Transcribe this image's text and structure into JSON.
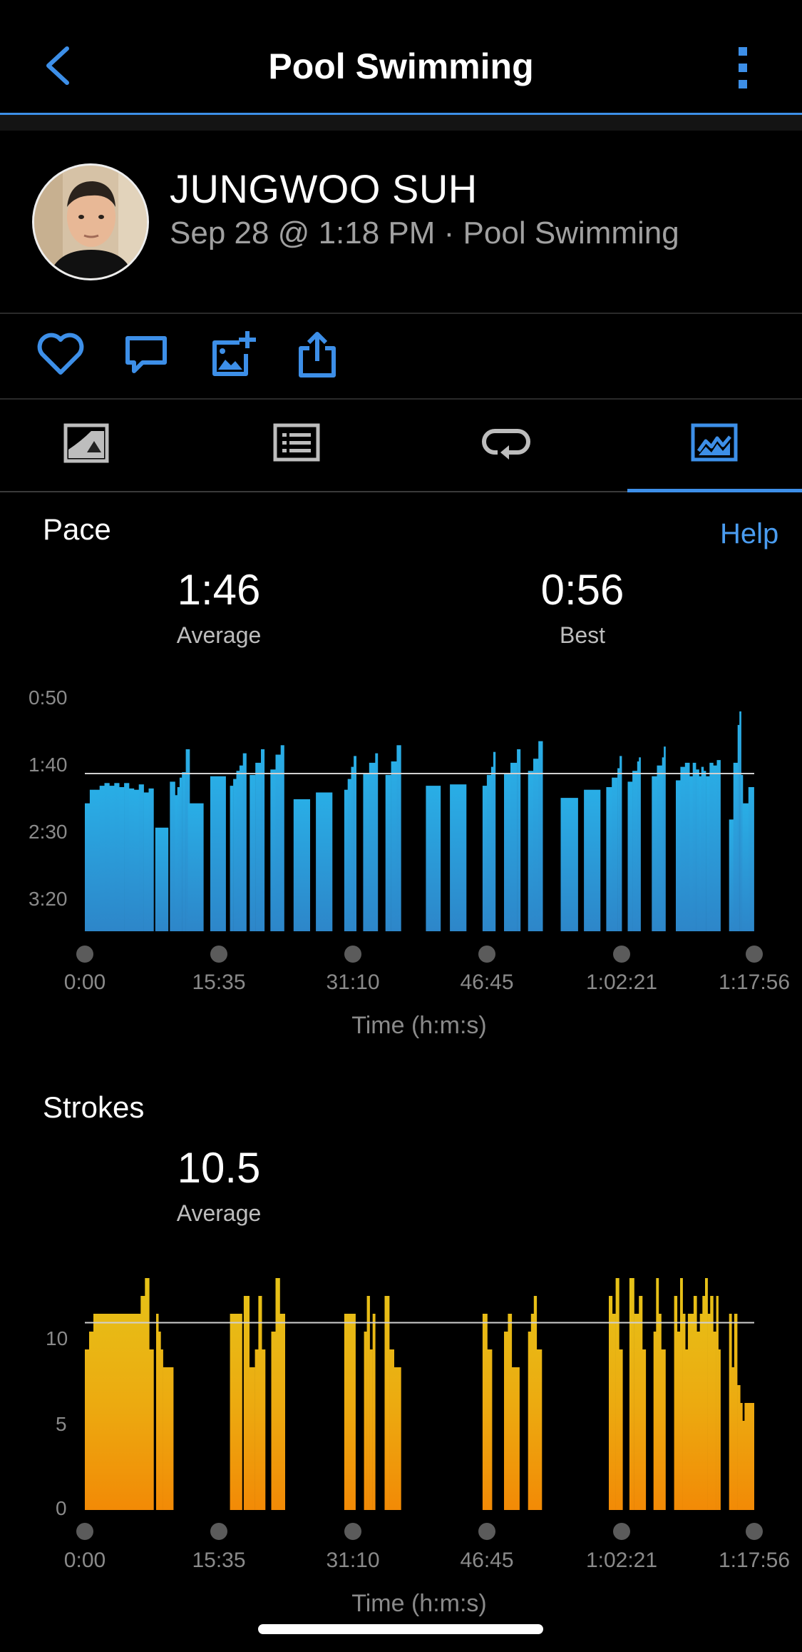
{
  "header": {
    "title": "Pool Swimming"
  },
  "profile": {
    "athlete_name": "JUNGWOO SUH",
    "subtitle": "Sep 28 @ 1:18 PM · Pool Swimming"
  },
  "actions": [
    {
      "icon": "heart-icon"
    },
    {
      "icon": "comment-icon"
    },
    {
      "icon": "add-photo-icon"
    },
    {
      "icon": "share-icon"
    }
  ],
  "tabs": [
    {
      "icon": "map-tab-icon"
    },
    {
      "icon": "list-tab-icon"
    },
    {
      "icon": "laps-tab-icon"
    },
    {
      "icon": "charts-tab-icon",
      "active": true
    }
  ],
  "pace": {
    "title": "Pace",
    "help": "Help",
    "average_value": "1:46",
    "average_label": "Average",
    "best_value": "0:56",
    "best_label": "Best"
  },
  "strokes": {
    "title": "Strokes",
    "average_value": "10.5",
    "average_label": "Average"
  },
  "colors": {
    "accent": "#3d8fe8",
    "pace_bar": "#29aee6",
    "strokes_top": "#e6c318",
    "strokes_bottom": "#f28a06"
  },
  "chart_data": [
    {
      "type": "bar",
      "name": "pace",
      "xlabel": "Time (h:m:s)",
      "ylabel": "",
      "x_ticks": [
        "0:00",
        "15:35",
        "31:10",
        "46:45",
        "1:02:21",
        "1:17:56"
      ],
      "y_ticks": [
        "0:50",
        "1:40",
        "2:30",
        "3:20"
      ],
      "ylim_seconds": [
        30,
        230
      ],
      "average_seconds": 106,
      "xlim_minutes": [
        0,
        77.93
      ],
      "intervals": [
        {
          "start": 0.0,
          "end": 8.0,
          "values": [
            128,
            118,
            118,
            115,
            113,
            115,
            113,
            116,
            113,
            117,
            118,
            114,
            120,
            117
          ]
        },
        {
          "start": 8.2,
          "end": 9.7,
          "values": [
            146
          ]
        },
        {
          "start": 9.9,
          "end": 10.5,
          "values": [
            112
          ]
        },
        {
          "start": 10.5,
          "end": 11.3,
          "values": [
            122,
            116,
            109
          ]
        },
        {
          "start": 11.3,
          "end": 12.2,
          "values": [
            105,
            88
          ]
        },
        {
          "start": 12.0,
          "end": 13.8,
          "values": [
            128
          ]
        },
        {
          "start": 14.6,
          "end": 16.4,
          "values": [
            108
          ]
        },
        {
          "start": 16.9,
          "end": 18.0,
          "values": [
            115,
            110,
            104
          ]
        },
        {
          "start": 18.0,
          "end": 18.8,
          "values": [
            100,
            91
          ]
        },
        {
          "start": 19.2,
          "end": 20.5,
          "values": [
            107,
            98
          ]
        },
        {
          "start": 20.5,
          "end": 20.9,
          "values": [
            88
          ]
        },
        {
          "start": 21.6,
          "end": 22.8,
          "values": [
            103,
            92
          ]
        },
        {
          "start": 22.8,
          "end": 23.2,
          "values": [
            85
          ]
        },
        {
          "start": 24.3,
          "end": 26.2,
          "values": [
            125
          ]
        },
        {
          "start": 26.9,
          "end": 28.8,
          "values": [
            120
          ]
        },
        {
          "start": 30.2,
          "end": 31.0,
          "values": [
            118,
            110
          ]
        },
        {
          "start": 31.0,
          "end": 31.6,
          "values": [
            101,
            93
          ]
        },
        {
          "start": 32.4,
          "end": 33.8,
          "values": [
            106,
            98
          ]
        },
        {
          "start": 33.8,
          "end": 34.1,
          "values": [
            91
          ]
        },
        {
          "start": 35.0,
          "end": 36.3,
          "values": [
            107,
            97
          ]
        },
        {
          "start": 36.3,
          "end": 36.8,
          "values": [
            85
          ]
        },
        {
          "start": 39.7,
          "end": 41.4,
          "values": [
            115
          ]
        },
        {
          "start": 42.5,
          "end": 44.4,
          "values": [
            114
          ]
        },
        {
          "start": 46.3,
          "end": 47.3,
          "values": [
            115,
            107
          ]
        },
        {
          "start": 47.3,
          "end": 47.8,
          "values": [
            101,
            90
          ]
        },
        {
          "start": 48.8,
          "end": 50.3,
          "values": [
            106,
            98
          ]
        },
        {
          "start": 50.3,
          "end": 50.7,
          "values": [
            88
          ]
        },
        {
          "start": 51.6,
          "end": 52.8,
          "values": [
            104,
            95
          ]
        },
        {
          "start": 52.8,
          "end": 53.3,
          "values": [
            82
          ]
        },
        {
          "start": 55.4,
          "end": 57.4,
          "values": [
            124
          ]
        },
        {
          "start": 58.1,
          "end": 60.0,
          "values": [
            118
          ]
        },
        {
          "start": 60.7,
          "end": 62.0,
          "values": [
            116,
            109
          ]
        },
        {
          "start": 62.0,
          "end": 62.5,
          "values": [
            102,
            93
          ]
        },
        {
          "start": 63.2,
          "end": 64.3,
          "values": [
            112,
            104
          ]
        },
        {
          "start": 64.3,
          "end": 64.7,
          "values": [
            97,
            94
          ]
        },
        {
          "start": 66.0,
          "end": 67.2,
          "values": [
            108,
            100
          ]
        },
        {
          "start": 67.2,
          "end": 67.6,
          "values": [
            94,
            86
          ]
        },
        {
          "start": 68.8,
          "end": 70.4,
          "values": [
            111,
            101,
            98
          ]
        },
        {
          "start": 70.4,
          "end": 71.5,
          "values": [
            108,
            98,
            103
          ]
        },
        {
          "start": 71.5,
          "end": 72.3,
          "values": [
            108,
            101,
            104
          ]
        },
        {
          "start": 72.3,
          "end": 74.0,
          "values": [
            108,
            98,
            100,
            96
          ]
        },
        {
          "start": 75.0,
          "end": 76.0,
          "values": [
            140,
            98
          ]
        },
        {
          "start": 76.0,
          "end": 76.6,
          "values": [
            70,
            60,
            107
          ]
        },
        {
          "start": 76.6,
          "end": 77.9,
          "values": [
            128,
            116
          ]
        }
      ]
    },
    {
      "type": "bar",
      "name": "strokes",
      "xlabel": "Time (h:m:s)",
      "ylabel": "",
      "x_ticks": [
        "0:00",
        "15:35",
        "31:10",
        "46:45",
        "1:02:21",
        "1:17:56"
      ],
      "y_ticks": [
        "10",
        "5",
        "0"
      ],
      "ylim": [
        0,
        13
      ],
      "average": 10.5,
      "xlim_minutes": [
        0,
        77.93
      ],
      "intervals": [
        {
          "start": 0.0,
          "end": 0.5,
          "values": [
            9
          ]
        },
        {
          "start": 0.5,
          "end": 1.0,
          "values": [
            10
          ]
        },
        {
          "start": 1.0,
          "end": 6.5,
          "values": [
            11
          ]
        },
        {
          "start": 6.5,
          "end": 7.0,
          "values": [
            12
          ]
        },
        {
          "start": 7.0,
          "end": 7.5,
          "values": [
            13
          ]
        },
        {
          "start": 7.5,
          "end": 8.0,
          "values": [
            9
          ]
        },
        {
          "start": 8.3,
          "end": 9.1,
          "values": [
            11,
            10,
            9
          ]
        },
        {
          "start": 9.1,
          "end": 10.3,
          "values": [
            8
          ]
        },
        {
          "start": 16.9,
          "end": 18.3,
          "values": [
            11
          ]
        },
        {
          "start": 18.5,
          "end": 19.8,
          "values": [
            12,
            8
          ]
        },
        {
          "start": 19.8,
          "end": 20.2,
          "values": [
            9
          ]
        },
        {
          "start": 20.2,
          "end": 20.6,
          "values": [
            12
          ]
        },
        {
          "start": 20.6,
          "end": 21.0,
          "values": [
            9
          ]
        },
        {
          "start": 21.7,
          "end": 22.7,
          "values": [
            10,
            13
          ]
        },
        {
          "start": 22.7,
          "end": 23.3,
          "values": [
            11
          ]
        },
        {
          "start": 30.2,
          "end": 31.5,
          "values": [
            11
          ]
        },
        {
          "start": 32.5,
          "end": 33.5,
          "values": [
            10,
            12,
            9
          ]
        },
        {
          "start": 33.5,
          "end": 33.8,
          "values": [
            11
          ]
        },
        {
          "start": 34.9,
          "end": 36.0,
          "values": [
            12,
            9
          ]
        },
        {
          "start": 36.0,
          "end": 36.8,
          "values": [
            8
          ]
        },
        {
          "start": 46.3,
          "end": 47.4,
          "values": [
            11,
            9
          ]
        },
        {
          "start": 48.8,
          "end": 49.7,
          "values": [
            10,
            11
          ]
        },
        {
          "start": 49.7,
          "end": 50.6,
          "values": [
            8
          ]
        },
        {
          "start": 51.6,
          "end": 52.6,
          "values": [
            10,
            11,
            12
          ]
        },
        {
          "start": 52.6,
          "end": 53.2,
          "values": [
            9
          ]
        },
        {
          "start": 61.0,
          "end": 62.2,
          "values": [
            12,
            11,
            13
          ]
        },
        {
          "start": 62.2,
          "end": 62.6,
          "values": [
            9
          ]
        },
        {
          "start": 63.4,
          "end": 64.5,
          "values": [
            13,
            11
          ]
        },
        {
          "start": 64.5,
          "end": 65.3,
          "values": [
            12,
            9
          ]
        },
        {
          "start": 66.2,
          "end": 67.1,
          "values": [
            10,
            13,
            11
          ]
        },
        {
          "start": 67.1,
          "end": 67.6,
          "values": [
            9
          ]
        },
        {
          "start": 68.6,
          "end": 69.3,
          "values": [
            12,
            10
          ]
        },
        {
          "start": 69.3,
          "end": 69.9,
          "values": [
            13,
            11
          ]
        },
        {
          "start": 69.9,
          "end": 70.5,
          "values": [
            9,
            11
          ]
        },
        {
          "start": 70.5,
          "end": 71.6,
          "values": [
            11,
            12,
            10
          ]
        },
        {
          "start": 71.6,
          "end": 72.2,
          "values": [
            11,
            12
          ]
        },
        {
          "start": 72.2,
          "end": 72.8,
          "values": [
            13,
            11
          ]
        },
        {
          "start": 72.8,
          "end": 73.5,
          "values": [
            12,
            10
          ]
        },
        {
          "start": 73.5,
          "end": 74.0,
          "values": [
            12,
            9
          ]
        },
        {
          "start": 75.0,
          "end": 75.6,
          "values": [
            11,
            8
          ]
        },
        {
          "start": 75.6,
          "end": 76.3,
          "values": [
            11,
            7
          ]
        },
        {
          "start": 76.3,
          "end": 76.8,
          "values": [
            6,
            5
          ]
        },
        {
          "start": 76.8,
          "end": 77.9,
          "values": [
            6
          ]
        }
      ]
    }
  ]
}
